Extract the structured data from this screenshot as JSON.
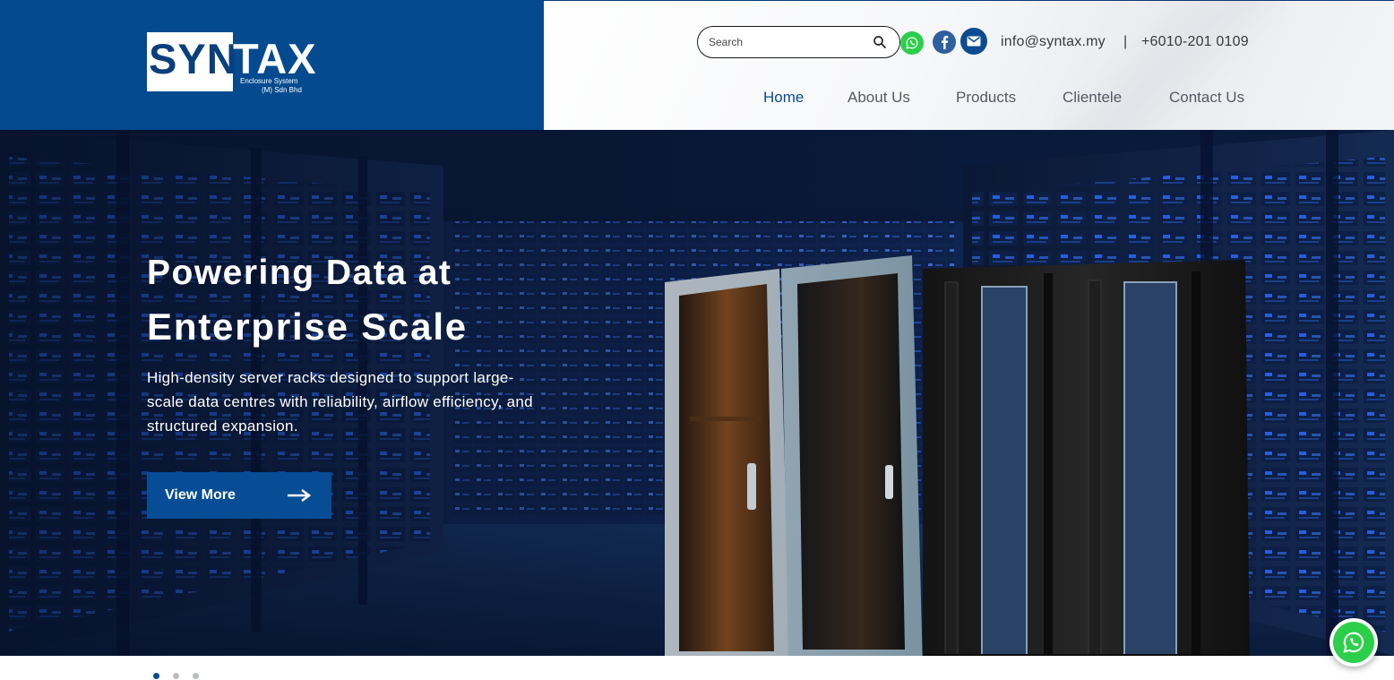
{
  "brand": {
    "logo_left": "SYN",
    "logo_right": "TAX",
    "tagline_1": "Enclosure System",
    "tagline_2": "(M) Sdn Bhd"
  },
  "search": {
    "placeholder": "Search",
    "icon": "search-icon"
  },
  "social": [
    {
      "name": "whatsapp",
      "icon": "whatsapp-icon",
      "color": "#2ccf4a"
    },
    {
      "name": "facebook",
      "icon": "facebook-icon",
      "color": "#2f5f9e"
    },
    {
      "name": "email",
      "icon": "mail-icon",
      "color": "#0b4b91"
    }
  ],
  "contact": {
    "email": "info@syntax.my",
    "separator": "|",
    "phone": "+6010-201 0109"
  },
  "nav": {
    "items": [
      {
        "label": "Home",
        "active": true
      },
      {
        "label": "About Us",
        "active": false
      },
      {
        "label": "Products",
        "active": false
      },
      {
        "label": "Clientele",
        "active": false
      },
      {
        "label": "Contact Us",
        "active": false
      }
    ]
  },
  "hero": {
    "title_line1": "Powering Data at",
    "title_line2": "Enterprise Scale",
    "description": "High-density server racks designed to support large-scale data centres with reliability, airflow efficiency, and structured expansion.",
    "button_label": "View More",
    "button_icon": "arrow-right-icon"
  },
  "carousel": {
    "slides_count": 3,
    "active_index": 0
  },
  "floating_whatsapp": {
    "icon": "whatsapp-icon"
  },
  "colors": {
    "primary": "#034a8f",
    "button": "#064d96",
    "whatsapp": "#2ccf4a",
    "nav_active": "#0b4b91",
    "nav_text": "#555b63"
  }
}
